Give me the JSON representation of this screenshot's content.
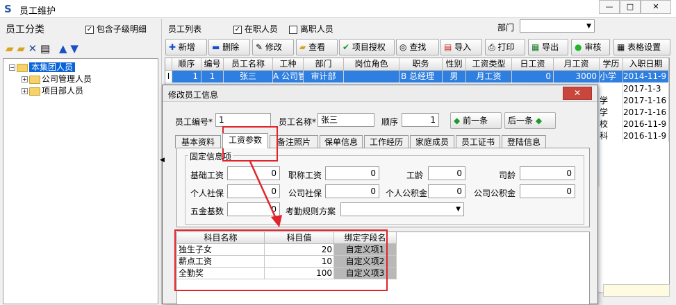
{
  "window": {
    "title": "员工维护"
  },
  "left": {
    "title": "员工分类",
    "include_sub_label": "包含子级明细",
    "tree": [
      {
        "label": "本集团人员",
        "selected": true
      },
      {
        "label": "公司管理人员"
      },
      {
        "label": "项目部人员"
      }
    ]
  },
  "list": {
    "title": "员工列表",
    "active_label": "在职人员",
    "left_label": "离职人员",
    "dept_label": "部门"
  },
  "toolbar": {
    "add": "新增",
    "delete": "删除",
    "edit": "修改",
    "view": "查看",
    "auth": "项目授权",
    "find": "查找",
    "import": "导入",
    "print": "打印",
    "export": "导出",
    "audit": "审核",
    "table_settings": "表格设置"
  },
  "grid": {
    "columns": [
      "顺序",
      "编号",
      "员工名称",
      "工种",
      "部门",
      "岗位角色",
      "职务",
      "性别",
      "工资类型",
      "日工资",
      "月工资",
      "学历",
      "入职日期"
    ],
    "row1": {
      "marker": "I",
      "order": "1",
      "code": "1",
      "name": "张三",
      "type": "A 公司管",
      "dept": "审计部",
      "role": "",
      "title": "B 总经理",
      "gender": "男",
      "wage_type": "月工资",
      "daily": "0",
      "monthly": "3000",
      "edu": "小学",
      "date": "2014-11-9"
    },
    "right_cells": [
      {
        "edu": "",
        "date": "2017-1-3"
      },
      {
        "edu": "学",
        "date": "2017-1-16"
      },
      {
        "edu": "学",
        "date": "2017-1-16"
      },
      {
        "edu": "校",
        "date": "2016-11-9"
      },
      {
        "edu": "科",
        "date": "2016-11-9"
      }
    ]
  },
  "dialog": {
    "title": "修改员工信息",
    "code_label": "员工编号*",
    "code_value": "1",
    "name_label": "员工名称*",
    "name_value": "张三",
    "order_label": "顺序",
    "order_value": "1",
    "prev": "前一条",
    "next": "后一条",
    "tabs": [
      "基本资料",
      "工资参数",
      "备注照片",
      "保单信息",
      "工作经历",
      "家庭成员",
      "员工证书",
      "登陆信息"
    ],
    "group_title": "固定信息项",
    "fields": {
      "basic_wage": {
        "label": "基础工资",
        "value": "0"
      },
      "title_wage": {
        "label": "职称工资",
        "value": "0"
      },
      "seniority": {
        "label": "工龄",
        "value": "0"
      },
      "driving_years": {
        "label": "司龄",
        "value": "0"
      },
      "personal_ss": {
        "label": "个人社保",
        "value": "0"
      },
      "company_ss": {
        "label": "公司社保",
        "value": "0"
      },
      "personal_hf": {
        "label": "个人公积金",
        "value": "0"
      },
      "company_hf": {
        "label": "公司公积金",
        "value": "0"
      },
      "insurance_base": {
        "label": "五金基数",
        "value": "0"
      },
      "attendance_plan": {
        "label": "考勤规则方案",
        "value": ""
      }
    },
    "subgrid": {
      "columns": [
        "科目名称",
        "科目值",
        "绑定字段名"
      ],
      "rows": [
        {
          "name": "独生子女",
          "value": "20",
          "field": "自定义项1"
        },
        {
          "name": "薪点工资",
          "value": "10",
          "field": "自定义项2"
        },
        {
          "name": "全勤奖",
          "value": "100",
          "field": "自定义项3"
        }
      ]
    }
  },
  "colors": {
    "selection": "#0a64d8",
    "highlight": "#e0242c"
  }
}
